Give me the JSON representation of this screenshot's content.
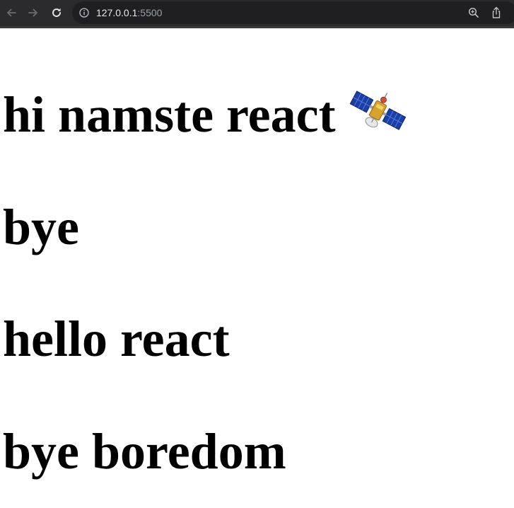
{
  "browser": {
    "url_host": "127.0.0.1",
    "url_port": ":5500"
  },
  "page": {
    "headings": [
      "hi namste react",
      "bye",
      "hello react",
      "bye boredom"
    ],
    "emoji": "satellite-icon"
  }
}
